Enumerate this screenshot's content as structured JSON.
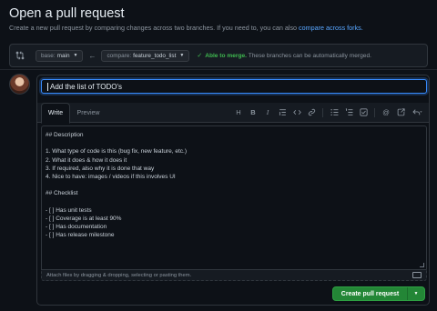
{
  "header": {
    "title": "Open a pull request",
    "subtitle_text": "Create a new pull request by comparing changes across two branches. If you need to, you can also",
    "subtitle_link": "compare across forks."
  },
  "compare": {
    "base_label": "base:",
    "base_value": "main",
    "compare_label": "compare:",
    "compare_value": "feature_todo_list",
    "merge_status": "Able to merge.",
    "merge_detail": "These branches can be automatically merged."
  },
  "pr": {
    "title_value": "Add the list of TODO's",
    "tabs": [
      "Write",
      "Preview"
    ],
    "toolbar_icons": [
      "heading-icon",
      "bold-icon",
      "italic-icon",
      "quote-icon",
      "code-icon",
      "link-icon",
      "unordered-list-icon",
      "ordered-list-icon",
      "task-list-icon",
      "mention-icon",
      "cross-reference-icon",
      "reply-icon"
    ],
    "body_lines": [
      "## Description",
      "",
      "1. What type of code is this (bug fix, new feature, etc.)",
      "2. What it does & how it does it",
      "3. If required, also why it is done that way",
      "4. Nice to have: images / videos if this involves UI",
      "",
      "## Checklist",
      "",
      "- [ ] Has unit tests",
      "- [ ] Coverage is at least 90%",
      "- [ ] Has documentation",
      "- [ ] Has release milestone"
    ],
    "attach_hint": "Attach files by dragging & dropping, selecting or pasting them.",
    "create_label": "Create pull request"
  },
  "colors": {
    "background": "#0d1117",
    "accent_blue": "#58a6ff",
    "success_green": "#3fb950",
    "button_green": "#238636"
  }
}
